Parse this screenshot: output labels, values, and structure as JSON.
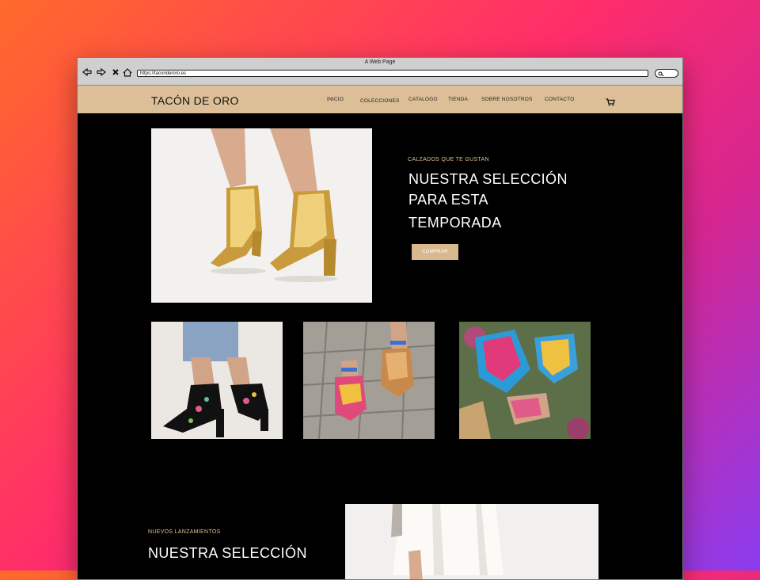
{
  "browser": {
    "window_title": "A Web Page",
    "url": "https://taconderoro.es"
  },
  "header": {
    "brand": "TACÓN DE ORO",
    "nav": [
      "INICIO",
      "COLECCIONES",
      "CATALOGO",
      "TIENDA",
      "SOBRE NOSOTROS",
      "CONTACTO"
    ]
  },
  "hero": {
    "kicker": "CALZADOS QUE TE GUSTAN",
    "title_line1": "NUESTRA SELECCIÓN",
    "title_line2": "PARA ESTA",
    "title_line3": "TEMPORADA",
    "button": "COMPRAR"
  },
  "releases": {
    "kicker": "NUEVOS LANZAMIENTOS",
    "title": "NUESTRA SELECCIÓN"
  },
  "colors": {
    "header_bg": "#dcbf97",
    "accent": "#e3c08e",
    "button_bg": "#d8b88f",
    "page_bg": "#000000"
  }
}
